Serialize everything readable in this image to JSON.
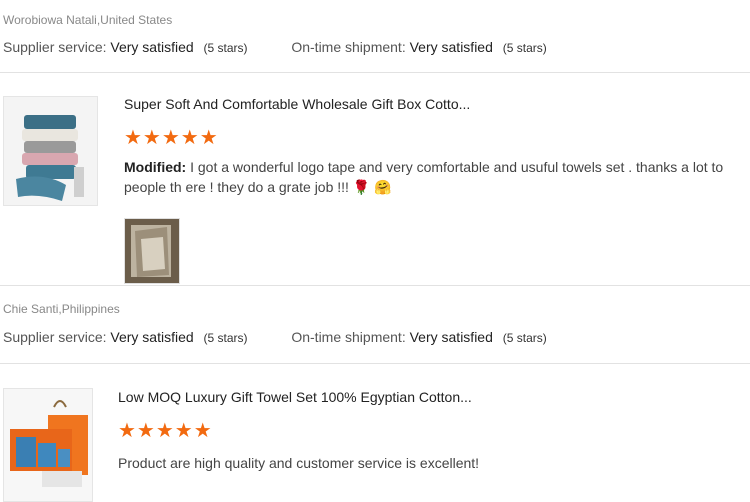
{
  "reviews": [
    {
      "reviewer": "Worobiowa Natali,United States",
      "supplier_label": "Supplier service:",
      "supplier_value": "Very satisfied",
      "supplier_stars": "(5 stars)",
      "shipment_label": "On-time shipment:",
      "shipment_value": "Very satisfied",
      "shipment_stars": "(5 stars)",
      "product_title": "Super Soft And Comfortable Wholesale Gift Box Cotto...",
      "rating": 5,
      "stars_text": "★★★★★",
      "comment_prefix": "Modified:",
      "comment": "I got a wonderful logo tape and very comfortable and usuful towels set . thanks a lot to people th ere ! they do a grate job !!!",
      "emoji": "🌹 🤗"
    },
    {
      "reviewer": "Chie Santi,Philippines",
      "supplier_label": "Supplier service:",
      "supplier_value": "Very satisfied",
      "supplier_stars": "(5 stars)",
      "shipment_label": "On-time shipment:",
      "shipment_value": "Very satisfied",
      "shipment_stars": "(5 stars)",
      "product_title": "Low MOQ Luxury Gift Towel Set 100% Egyptian Cotton...",
      "rating": 5,
      "stars_text": "★★★★★",
      "comment": "Product are high quality and customer service is excellent!"
    }
  ],
  "colors": {
    "star": "#f26a10",
    "divider": "#e2e2e2"
  }
}
